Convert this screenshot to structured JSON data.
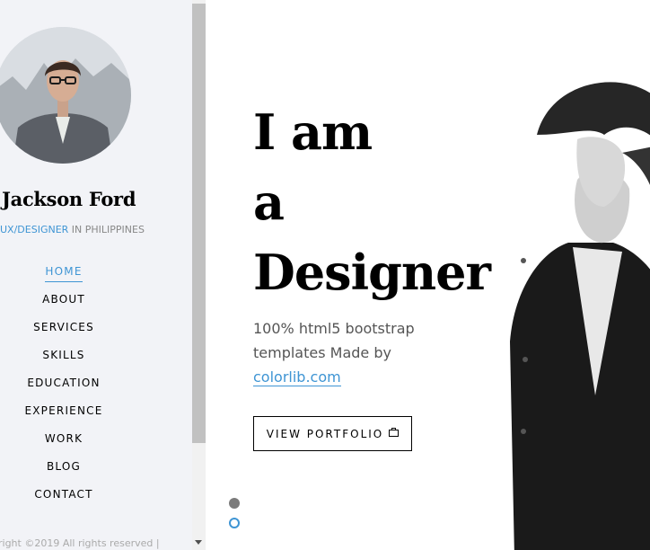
{
  "profile": {
    "name": "Jackson Ford",
    "role_accent": "UX/DESIGNER",
    "role_rest": " IN PHILIPPINES"
  },
  "nav": {
    "items": [
      {
        "label": "HOME",
        "active": true
      },
      {
        "label": "ABOUT",
        "active": false
      },
      {
        "label": "SERVICES",
        "active": false
      },
      {
        "label": "SKILLS",
        "active": false
      },
      {
        "label": "EDUCATION",
        "active": false
      },
      {
        "label": "EXPERIENCE",
        "active": false
      },
      {
        "label": "WORK",
        "active": false
      },
      {
        "label": "BLOG",
        "active": false
      },
      {
        "label": "CONTACT",
        "active": false
      }
    ]
  },
  "footer": {
    "copyright": "right ©2019 All rights reserved |"
  },
  "hero": {
    "headline_line1": "I am",
    "headline_line2": "a",
    "headline_line3": "Designer",
    "subtext": "100% html5 bootstrap templates Made by",
    "link_text": "colorlib.com",
    "button_label": "VIEW PORTFOLIO",
    "button_icon": "briefcase-icon"
  },
  "slider": {
    "total_slides": 2,
    "active_slide": 1
  },
  "colors": {
    "accent": "#3f95d4",
    "sidebar_bg": "#f2f3f7",
    "text": "#000000"
  }
}
